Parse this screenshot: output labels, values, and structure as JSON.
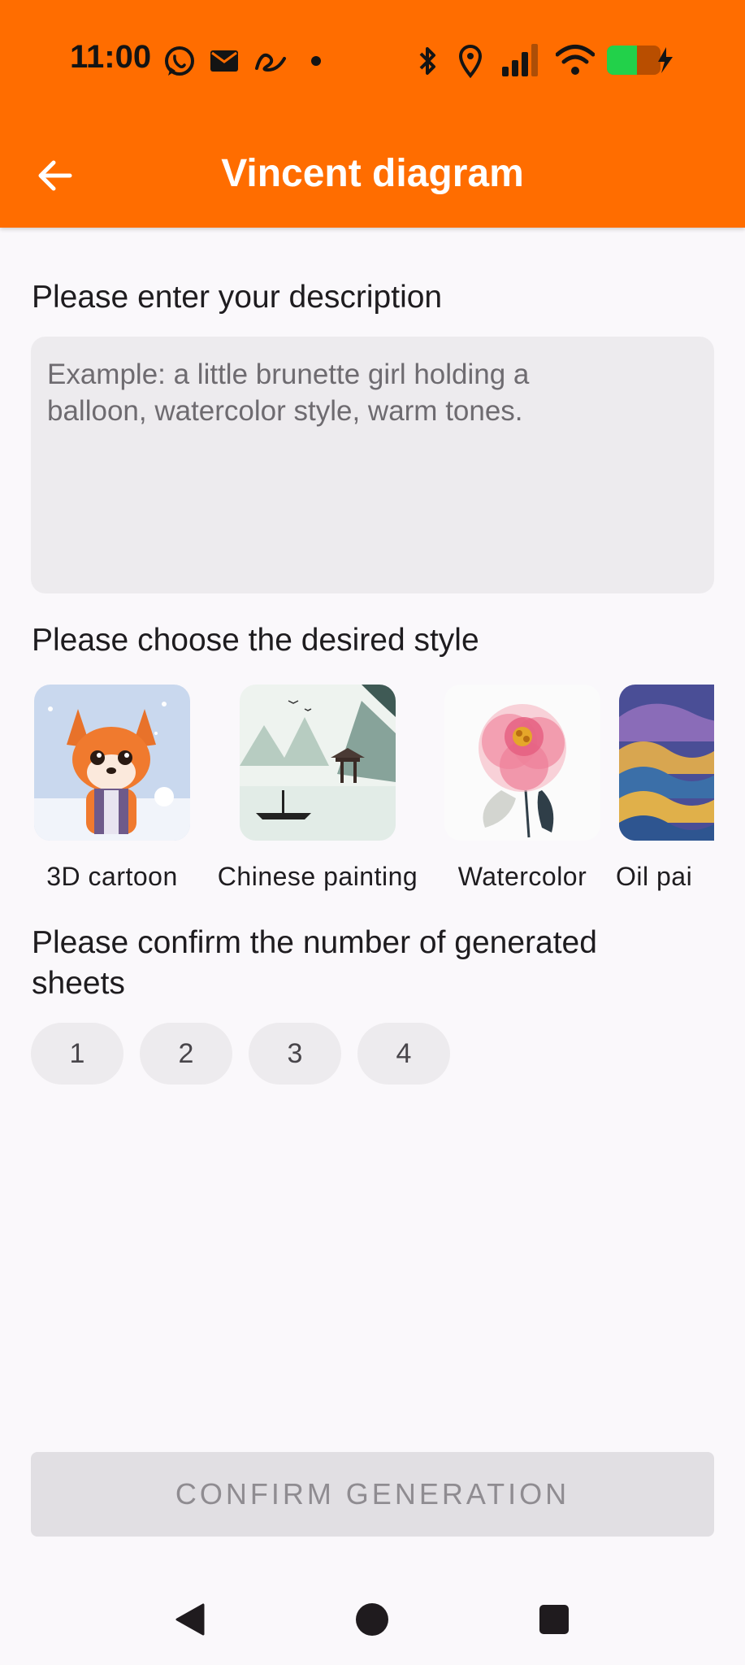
{
  "status_bar": {
    "time": "11:00",
    "left_icons": [
      "whatsapp-icon",
      "mail-icon",
      "app-notification-icon",
      "dot-icon"
    ],
    "right_icons": [
      "bluetooth-icon",
      "location-icon",
      "signal-icon",
      "wifi-icon",
      "battery-charging-icon"
    ]
  },
  "app_bar": {
    "title": "Vincent diagram",
    "background_color": "#FF6D00",
    "back_icon": "arrow-left-icon"
  },
  "description": {
    "label": "Please enter your description",
    "placeholder_line1": "Example: a little brunette girl holding a",
    "placeholder_line2": "balloon, watercolor style, warm tones.",
    "value": ""
  },
  "style": {
    "label": "Please choose the desired style",
    "items": [
      {
        "name": "3D cartoon",
        "image": "fox-cartoon-image"
      },
      {
        "name": "Chinese painting",
        "image": "ink-landscape-image"
      },
      {
        "name": "Watercolor",
        "image": "peony-watercolor-image"
      },
      {
        "name": "Oil pai",
        "image": "oil-waves-image"
      }
    ]
  },
  "sheets": {
    "label_line1": "Please confirm the number of generated",
    "label_line2": "sheets",
    "options": [
      "1",
      "2",
      "3",
      "4"
    ]
  },
  "confirm_button": {
    "label": "CONFIRM GENERATION",
    "enabled": false
  },
  "nav_bar": {
    "icons": [
      "back-triangle-icon",
      "home-circle-icon",
      "recents-square-icon"
    ]
  }
}
